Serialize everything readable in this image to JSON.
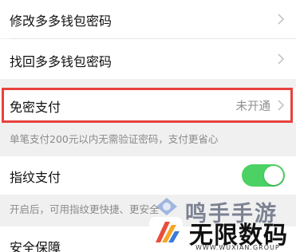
{
  "settings": {
    "rows": [
      {
        "label": "修改多多钱包密码"
      },
      {
        "label": "找回多多钱包密码"
      },
      {
        "label": "免密支付",
        "status": "未开通"
      },
      {
        "label": "指纹支付",
        "toggle_on": true
      },
      {
        "label": "安全保障"
      }
    ],
    "notes": {
      "password_free": "单笔支付200元以内无需验证密码，支付更省心",
      "fingerprint": "开启后，可用指纹更快捷、更安全"
    }
  },
  "watermark": {
    "top_text": "鸣手手游",
    "main_text": "无限数码",
    "sub_text": "WWW.WUXIAN.GROUP"
  },
  "colors": {
    "toggle_on": "#4cd264",
    "highlight": "#e8413d",
    "background": "#f0f0f0"
  }
}
